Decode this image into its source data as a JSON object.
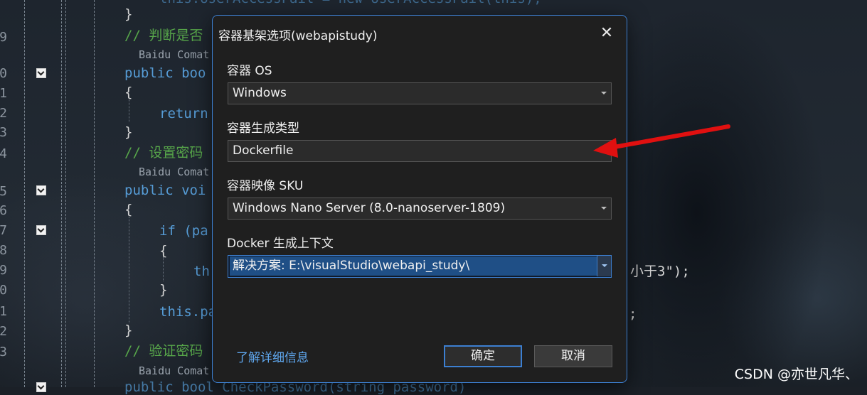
{
  "editor": {
    "line_numbers": [
      "9",
      "0",
      "1",
      "2",
      "3",
      "4",
      "5",
      "6",
      "7",
      "8",
      "9",
      "0",
      "1",
      "2",
      "3"
    ],
    "code_lines": [
      {
        "text": "this.UserAccessFail = new UserAccessFail(this);",
        "kind": "code-faded"
      },
      {
        "text": "}",
        "kind": "code"
      },
      {
        "text": "// 判断是否",
        "kind": "comment"
      },
      {
        "text": "Baidu Comat",
        "kind": "lens"
      },
      {
        "text": "public boo",
        "kind": "keyword"
      },
      {
        "text": "{",
        "kind": "code"
      },
      {
        "text": "return",
        "kind": "keyword"
      },
      {
        "text": "}",
        "kind": "code"
      },
      {
        "text": "// 设置密码",
        "kind": "comment"
      },
      {
        "text": "Baidu Comat",
        "kind": "lens"
      },
      {
        "text": "public voi",
        "kind": "keyword"
      },
      {
        "text": "{",
        "kind": "code"
      },
      {
        "text": "if (pa",
        "kind": "keyword-mixed"
      },
      {
        "text": "{",
        "kind": "code"
      },
      {
        "text": "thr",
        "kind": "keyword"
      },
      {
        "text": "小于3\");",
        "kind": "code-right"
      },
      {
        "text": "}",
        "kind": "code"
      },
      {
        "text": "this.pa",
        "kind": "keyword-mixed"
      },
      {
        "text": ";",
        "kind": "code-right"
      },
      {
        "text": "}",
        "kind": "code"
      },
      {
        "text": "// 验证密码",
        "kind": "comment"
      },
      {
        "text": "Baidu Comat",
        "kind": "lens"
      },
      {
        "text": "public bool CheckPassword(string password)",
        "kind": "code-faded"
      }
    ]
  },
  "dialog": {
    "title": "容器基架选项(webapistudy)",
    "fields": [
      {
        "label": "容器 OS",
        "value": "Windows"
      },
      {
        "label": "容器生成类型",
        "value": "Dockerfile"
      },
      {
        "label": "容器映像 SKU",
        "value": "Windows Nano Server (8.0-nanoserver-1809)"
      },
      {
        "label": "Docker 生成上下文",
        "value": "解决方案: E:\\visualStudio\\webapi_study\\"
      }
    ],
    "learn_more": "了解详细信息",
    "ok_label": "确定",
    "cancel_label": "取消"
  },
  "watermark": "CSDN @亦世凡华、",
  "colors": {
    "accent": "#3c7fd1",
    "link": "#5fa8f0",
    "annotation_arrow": "#e01010",
    "comment": "#57a64a",
    "keyword": "#569cd6"
  },
  "icons": [
    "close-icon",
    "chevron-down-icon",
    "fold-marker-icon",
    "red-arrow-annotation"
  ]
}
